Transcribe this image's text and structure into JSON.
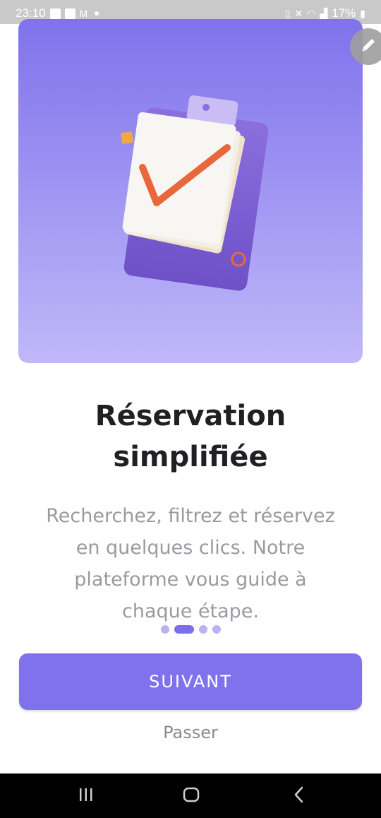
{
  "status_bar": {
    "time": "23:10",
    "battery": "17%",
    "left_icons": [
      "image-icon",
      "check-box-icon",
      "mail-icon"
    ],
    "right_icons": [
      "battery-saver-icon",
      "mute-icon",
      "wifi-icon",
      "signal-icon",
      "battery-icon"
    ]
  },
  "hero": {
    "illustration": "clipboard-checkmark-illustration",
    "edit_icon": "pencil-icon",
    "colors": {
      "gradient_top": "#7f72ec",
      "gradient_bottom": "#c0b8f8",
      "check": "#e8683c"
    }
  },
  "onboarding": {
    "title_line1": "Réservation",
    "title_line2": "simplifiée",
    "description_lines": [
      "Recherchez, filtrez et réservez",
      "en quelques clics. Notre",
      "plateforme vous guide à",
      "chaque étape."
    ],
    "page_count": 4,
    "current_page": 2
  },
  "actions": {
    "next_label": "SUIVANT",
    "skip_label": "Passer"
  },
  "colors": {
    "accent": "#7f72ec",
    "title": "#1f1f24",
    "body_text": "#9a9aa0"
  },
  "nav_bar": {
    "buttons": [
      "recents-icon",
      "home-icon",
      "back-icon"
    ]
  }
}
